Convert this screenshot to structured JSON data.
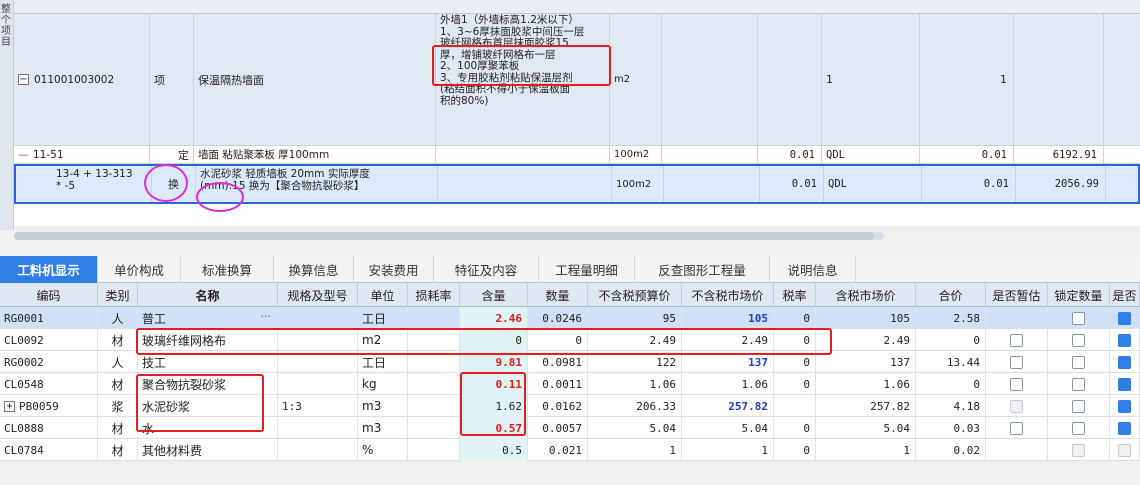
{
  "left_panel": {
    "vertical_text": "整个项目"
  },
  "top_grid": {
    "rows": [
      {
        "code": "011001003002",
        "type": "项",
        "name": "保温隔热墙面",
        "feature": "外墙1（外墙标高1.2米以下）\n1、3~6厚抹面胶浆中间压一层\n玻纤网格布首层抹面胶浆15\n厚，增铺玻纤网格布一层\n2、100厚聚苯板\n3、专用胶粘剂粘贴保温层剂\n(粘结面积不得小于保温板面\n积的80%)",
        "unit": "m2",
        "col_a": "",
        "col_b": "",
        "col_c": "1",
        "col_d": "1",
        "col_e": ""
      },
      {
        "code": "11-51",
        "type": "定",
        "name": "墙面 粘贴聚苯板 厚100mm",
        "feature": "",
        "unit": "100m2",
        "col_a": "",
        "col_b": "0.01",
        "col_c": "QDL",
        "col_d": "0.01",
        "col_e": "6192.91"
      },
      {
        "code": "13-4 + 13-313\n* -5",
        "type": "换",
        "name": "水泥砂浆 轻质墙板 20mm  实际厚度\n(mm):15  换为【聚合物抗裂砂浆】",
        "feature": "",
        "unit": "100m2",
        "col_a": "",
        "col_b": "0.01",
        "col_c": "QDL",
        "col_d": "0.01",
        "col_e": "2056.99"
      }
    ]
  },
  "tabs": [
    "工料机显示",
    "单价构成",
    "标准换算",
    "换算信息",
    "安装费用",
    "特征及内容",
    "工程量明细",
    "反查图形工程量",
    "说明信息"
  ],
  "table": {
    "headers": [
      "编码",
      "类别",
      "名称",
      "规格及型号",
      "单位",
      "损耗率",
      "含量",
      "数量",
      "不含税预算价",
      "不含税市场价",
      "税率",
      "含税市场价",
      "合价",
      "是否暂估",
      "锁定数量",
      "是否"
    ],
    "rows": [
      {
        "code": "RG0001",
        "cat": "人",
        "name": "普工",
        "spec": "",
        "unit": "工日",
        "loss": "",
        "qty": "2.46",
        "amount": "0.0246",
        "budget": "95",
        "market": "105",
        "tax": "0",
        "taxmarket": "105",
        "total": "2.58"
      },
      {
        "code": "CL0092",
        "cat": "材",
        "name": "玻璃纤维网格布",
        "spec": "",
        "unit": "m2",
        "loss": "",
        "qty": "0",
        "amount": "0",
        "budget": "2.49",
        "market": "2.49",
        "tax": "0",
        "taxmarket": "2.49",
        "total": "0"
      },
      {
        "code": "RG0002",
        "cat": "人",
        "name": "技工",
        "spec": "",
        "unit": "工日",
        "loss": "",
        "qty": "9.81",
        "amount": "0.0981",
        "budget": "122",
        "market": "137",
        "tax": "0",
        "taxmarket": "137",
        "total": "13.44"
      },
      {
        "code": "CL0548",
        "cat": "材",
        "name": "聚合物抗裂砂浆",
        "spec": "",
        "unit": "kg",
        "loss": "",
        "qty": "0.11",
        "amount": "0.0011",
        "budget": "1.06",
        "market": "1.06",
        "tax": "0",
        "taxmarket": "1.06",
        "total": "0"
      },
      {
        "code": "PB0059",
        "cat": "浆",
        "name": "水泥砂浆",
        "spec": "1:3",
        "unit": "m3",
        "loss": "",
        "qty": "1.62",
        "amount": "0.0162",
        "budget": "206.33",
        "market": "257.82",
        "tax": "",
        "taxmarket": "257.82",
        "total": "4.18"
      },
      {
        "code": "CL0888",
        "cat": "材",
        "name": "水",
        "spec": "",
        "unit": "m3",
        "loss": "",
        "qty": "0.57",
        "amount": "0.0057",
        "budget": "5.04",
        "market": "5.04",
        "tax": "0",
        "taxmarket": "5.04",
        "total": "0.03"
      },
      {
        "code": "CL0784",
        "cat": "材",
        "name": "其他材料费",
        "spec": "",
        "unit": "%",
        "loss": "",
        "qty": "0.5",
        "amount": "0.021",
        "budget": "1",
        "market": "1",
        "tax": "0",
        "taxmarket": "1",
        "total": "0.02"
      }
    ]
  },
  "colors": {
    "accent": "#2f7ee6",
    "annotation_red": "#e41e1e",
    "annotation_magenta": "#e02bd6"
  }
}
